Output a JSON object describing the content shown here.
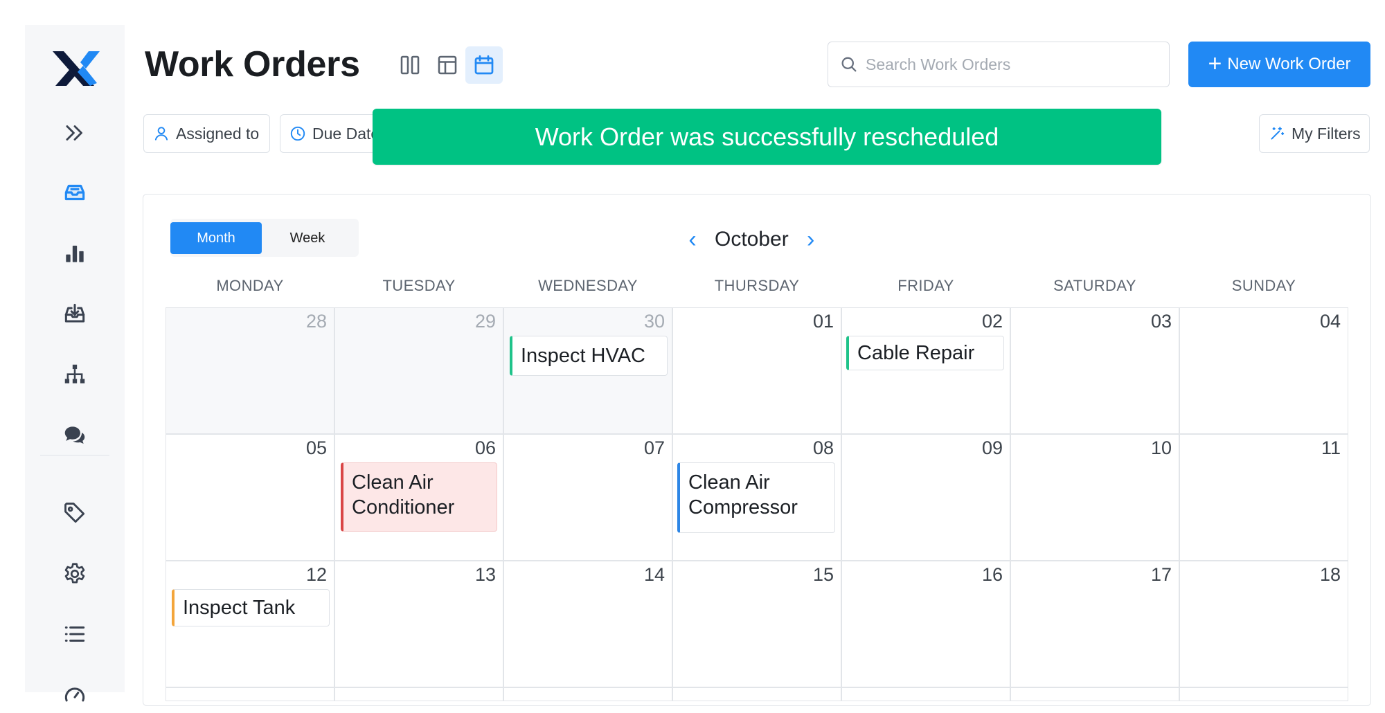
{
  "page": {
    "title": "Work Orders"
  },
  "sidebar": {
    "items": [
      {
        "name": "expand",
        "icon": "double-chevron-right-icon"
      },
      {
        "name": "work-orders",
        "icon": "inbox-icon",
        "active": true
      },
      {
        "name": "reports",
        "icon": "bar-chart-icon"
      },
      {
        "name": "requests",
        "icon": "tray-download-icon"
      },
      {
        "name": "locations",
        "icon": "hierarchy-icon"
      },
      {
        "name": "messages",
        "icon": "chat-icon"
      },
      {
        "name": "tags",
        "icon": "tag-icon"
      },
      {
        "name": "settings",
        "icon": "gear-icon"
      },
      {
        "name": "list",
        "icon": "list-icon"
      },
      {
        "name": "meters",
        "icon": "gauge-icon"
      }
    ]
  },
  "header": {
    "search_placeholder": "Search Work Orders",
    "new_button_label": "New Work Order",
    "views": [
      "board-view",
      "table-view",
      "calendar-view"
    ],
    "active_view": "calendar-view"
  },
  "filters": {
    "assigned_to": "Assigned to",
    "due_date": "Due Date",
    "my_filters": "My Filters"
  },
  "toast": {
    "message": "Work Order was successfully rescheduled"
  },
  "calendar": {
    "modes": {
      "month": "Month",
      "week": "Week",
      "active": "Month"
    },
    "month_label": "October",
    "weekdays": [
      "MONDAY",
      "TUESDAY",
      "WEDNESDAY",
      "THURSDAY",
      "FRIDAY",
      "SATURDAY",
      "SUNDAY"
    ],
    "weeks": [
      [
        "28",
        "29",
        "30",
        "01",
        "02",
        "03",
        "04"
      ],
      [
        "05",
        "06",
        "07",
        "08",
        "09",
        "10",
        "11"
      ],
      [
        "12",
        "13",
        "14",
        "15",
        "16",
        "17",
        "18"
      ]
    ],
    "events": [
      {
        "title": "Inspect HVAC",
        "day": "30",
        "color": "#1fc38a"
      },
      {
        "title": "Cable Repair",
        "day": "02",
        "color": "#1fc38a"
      },
      {
        "title": "Clean Air Conditioner",
        "day": "06",
        "color": "#d94545"
      },
      {
        "title": "Clean Air Compressor",
        "day": "08",
        "color": "#2d86e6"
      },
      {
        "title": "Inspect Tank",
        "day": "12",
        "color": "#f3a53b"
      }
    ]
  },
  "colors": {
    "accent": "#2189f4",
    "success": "#00c283",
    "brand_dark": "#0e1a3a"
  }
}
